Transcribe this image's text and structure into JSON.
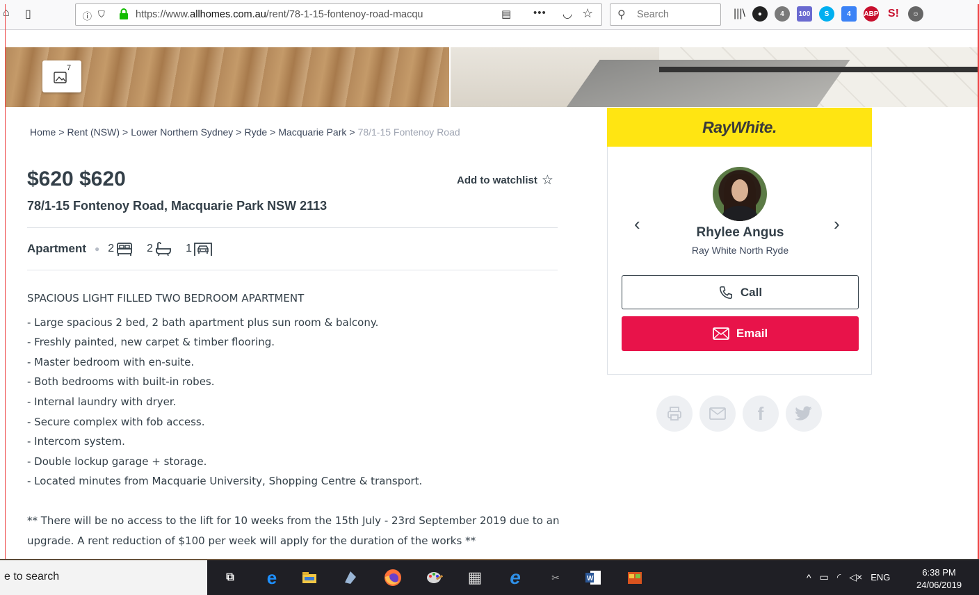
{
  "browser": {
    "url_prefix": "https://www.",
    "url_domain": "allhomes.com.au",
    "url_path": "/rent/78-1-15-fontenoy-road-macqu",
    "search_placeholder": "Search"
  },
  "gallery": {
    "count": "7"
  },
  "breadcrumb": [
    {
      "label": "Home"
    },
    {
      "label": "Rent (NSW)"
    },
    {
      "label": "Lower Northern Sydney"
    },
    {
      "label": "Ryde"
    },
    {
      "label": "Macquarie Park"
    }
  ],
  "breadcrumb_current": "78/1-15 Fontenoy Road",
  "breadcrumb_sep": ">",
  "listing": {
    "price": "$620 $620",
    "address": "78/1-15 Fontenoy Road, Macquarie Park NSW 2113",
    "watchlist_label": "Add to watchlist",
    "property_type": "Apartment",
    "bedrooms": "2",
    "bathrooms": "2",
    "parking": "1",
    "headline": "SPACIOUS LIGHT FILLED TWO BEDROOM APARTMENT",
    "bullets": [
      "- Large spacious 2 bed, 2 bath apartment plus sun room & balcony.",
      "- Freshly painted, new carpet & timber flooring.",
      "- Master bedroom with en-suite.",
      "- Both bedrooms with built-in robes.",
      "- Internal laundry with dryer.",
      "- Secure complex with fob access.",
      "- Intercom system.",
      "- Double lockup garage + storage.",
      "- Located minutes from Macquarie University, Shopping Centre & transport."
    ],
    "notice": "** There will be no access to the lift for 10 weeks from the 15th July - 23rd September 2019 due to an upgrade. A rent reduction of $100 per week will apply for the duration of the works **"
  },
  "agent": {
    "agency_logo": "RayWhite.",
    "name": "Rhylee Angus",
    "agency": "Ray White North Ryde",
    "call_label": "Call",
    "email_label": "Email"
  },
  "colors": {
    "agency_yellow": "#ffe512",
    "email_red": "#e8134a"
  },
  "taskbar": {
    "search_text": "e to search",
    "language": "ENG",
    "time": "6:38 PM",
    "date": "24/06/2019"
  }
}
